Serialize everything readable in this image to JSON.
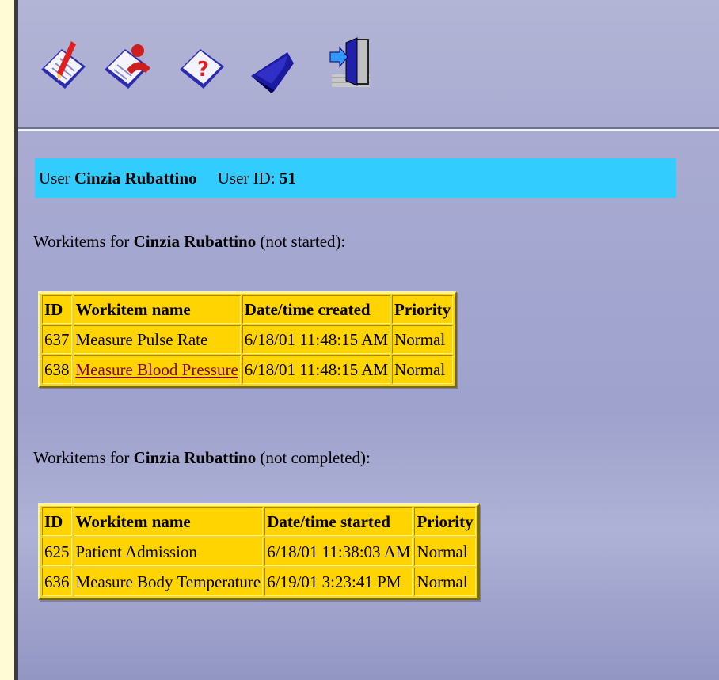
{
  "toolbar": {
    "icons": [
      "clipboard-pen-icon",
      "clipboard-user-icon",
      "clipboard-question-icon",
      "folder-back-icon",
      "exit-door-icon"
    ]
  },
  "user": {
    "label": "User",
    "name": "Cinzia Rubattino",
    "id_label": "User ID:",
    "id": "51"
  },
  "section_not_started": {
    "prefix": "Workitems for",
    "name": "Cinzia Rubattino",
    "suffix": "(not started):",
    "columns": [
      "ID",
      "Workitem name",
      "Date/time created",
      "Priority"
    ],
    "rows": [
      {
        "id": "637",
        "name": "Measure Pulse Rate",
        "date": "6/18/01 11:48:15 AM",
        "priority": "Normal"
      },
      {
        "id": "638",
        "name": "Measure Blood Pressure",
        "date": "6/18/01 11:48:15 AM",
        "priority": "Normal"
      }
    ]
  },
  "section_not_completed": {
    "prefix": "Workitems for",
    "name": "Cinzia Rubattino",
    "suffix": "(not completed):",
    "columns": [
      "ID",
      "Workitem name",
      "Date/time started",
      "Priority"
    ],
    "rows": [
      {
        "id": "625",
        "name": "Patient Admission",
        "date": "6/18/01 11:38:03 AM",
        "priority": "Normal"
      },
      {
        "id": "636",
        "name": "Measure Body Temperature",
        "date": "6/19/01 3:23:41 PM",
        "priority": "Normal"
      }
    ]
  },
  "colors": {
    "user_bar": "#33ccff",
    "table_bg": "#ffd400",
    "link": "#800040"
  }
}
